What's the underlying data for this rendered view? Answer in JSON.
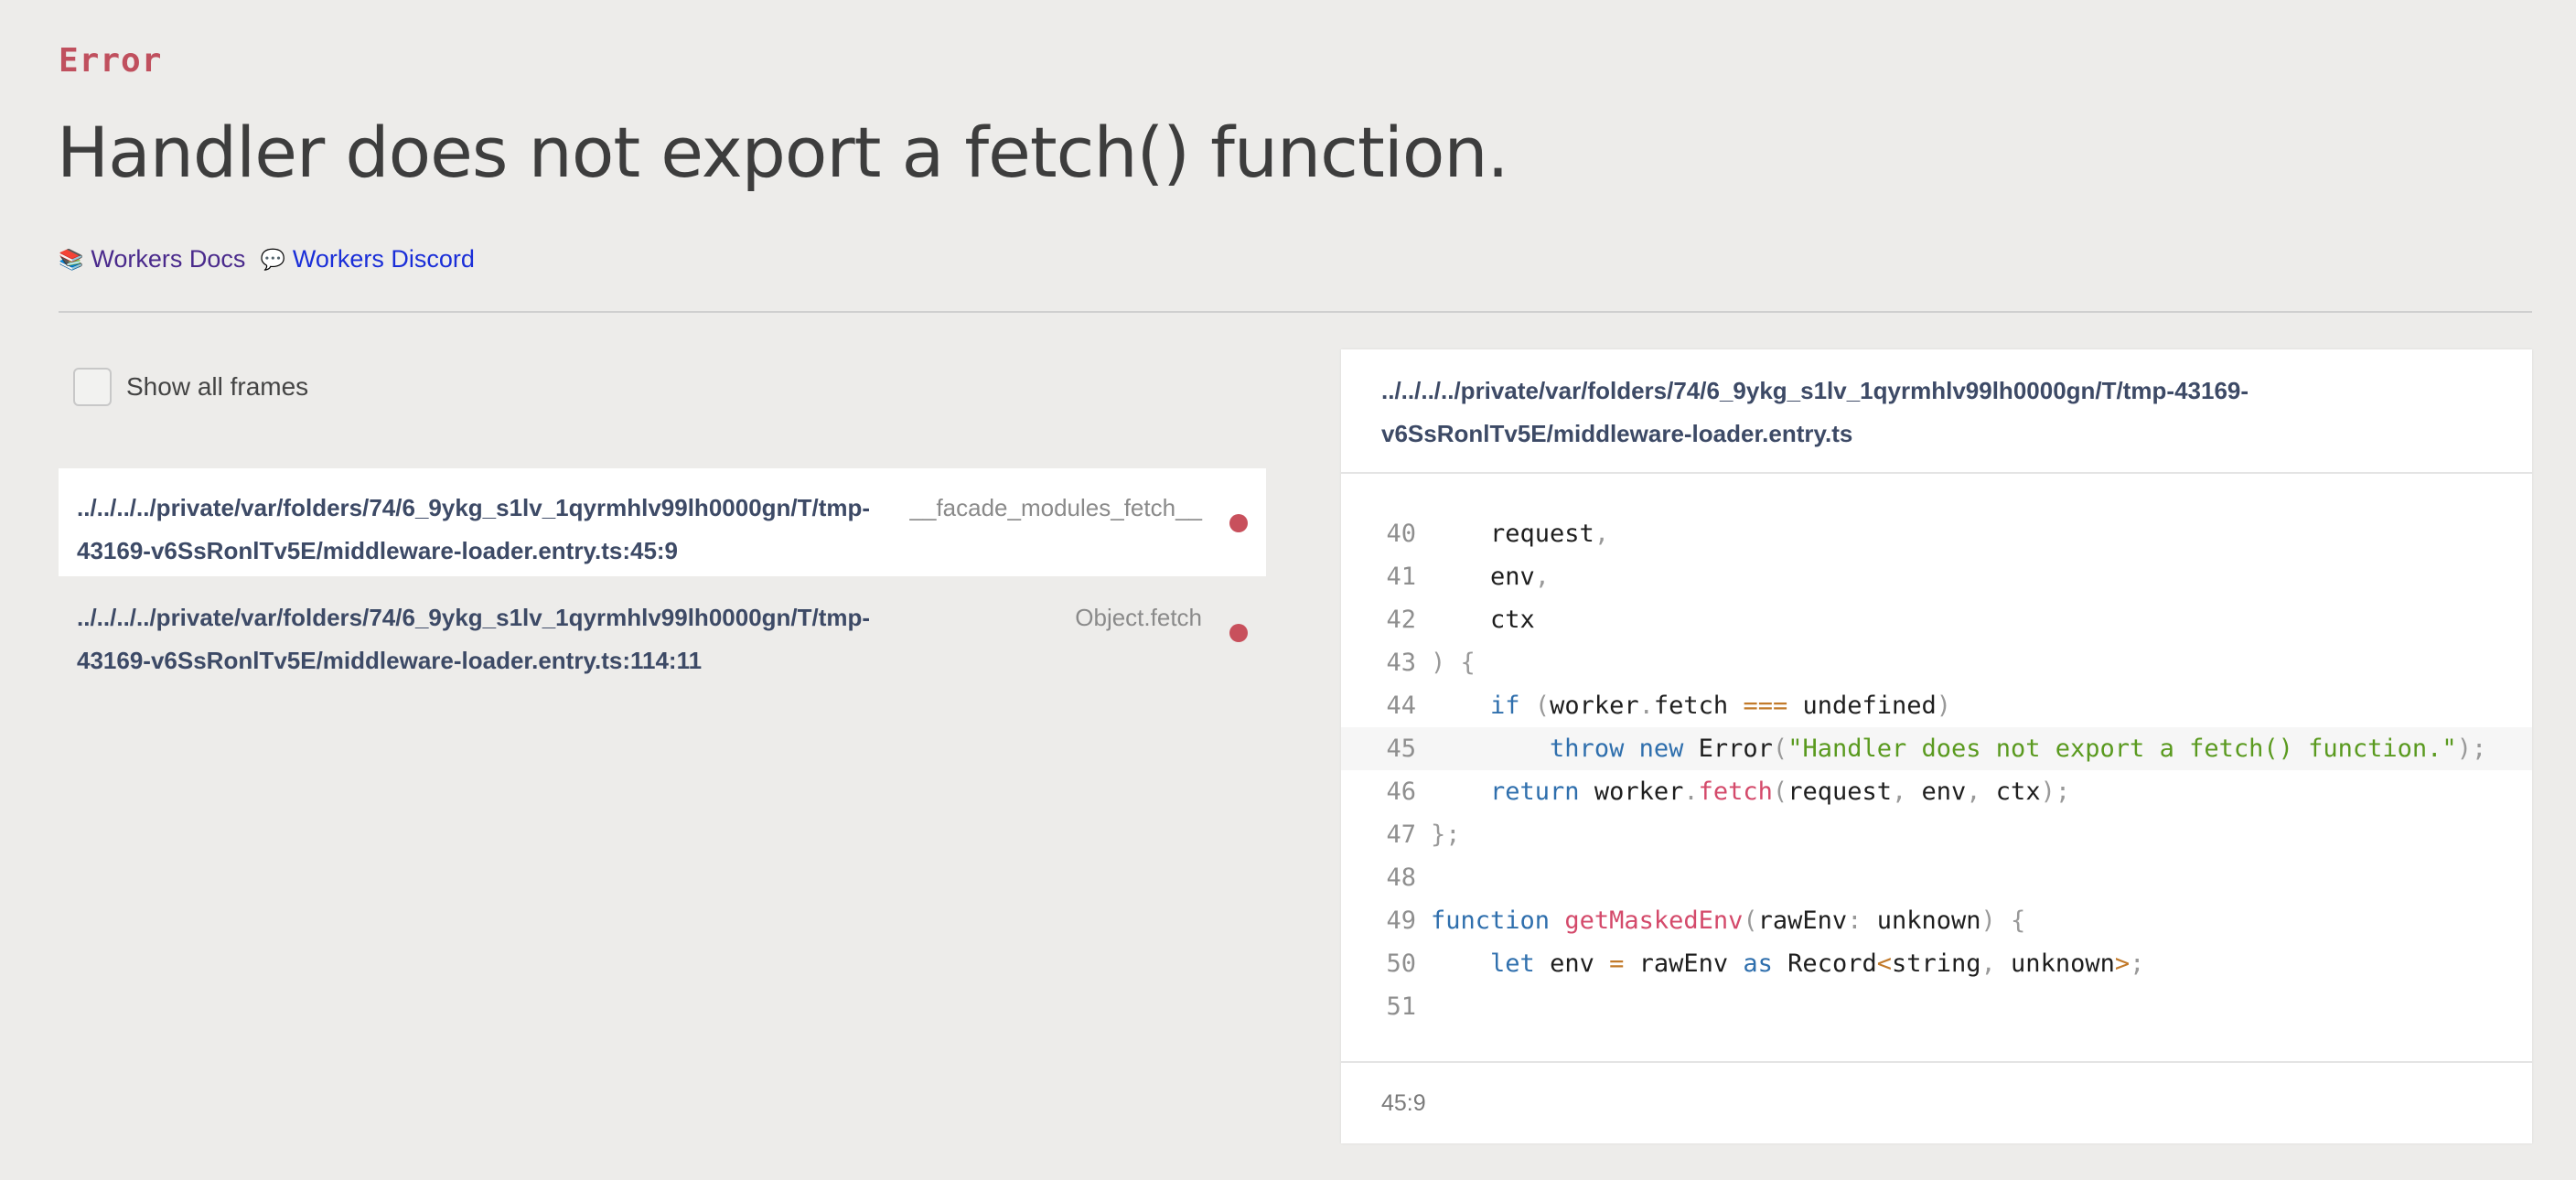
{
  "header": {
    "tag": "Error",
    "title": "Handler does not export a fetch() function."
  },
  "links": [
    {
      "icon": "books-emoji-icon",
      "glyph": "📚",
      "label": "Workers Docs",
      "color": "#4a2a8c"
    },
    {
      "icon": "speech-bubble-emoji-icon",
      "glyph": "💬",
      "label": "Workers Discord",
      "color": "#1a2ed8"
    }
  ],
  "frames_toggle": {
    "label": "Show all frames",
    "checked": false
  },
  "frames": [
    {
      "location": "../../../../private/var/folders/74/6_9ykg_s1lv_1qyrmhlv99lh0000gn/T/tmp-43169-v6SsRonlTv5E/middleware-loader.entry.ts:45:9",
      "function": "__facade_modules_fetch__",
      "active": true
    },
    {
      "location": "../../../../private/var/folders/74/6_9ykg_s1lv_1qyrmhlv99lh0000gn/T/tmp-43169-v6SsRonlTv5E/middleware-loader.entry.ts:114:11",
      "function": "Object.fetch",
      "active": false
    }
  ],
  "code_panel": {
    "file_path": "../../../../private/var/folders/74/6_9ykg_s1lv_1qyrmhlv99lh0000gn/T/tmp-43169-v6SsRonlTv5E/middleware-loader.entry.ts",
    "highlight_line": 45,
    "lines": [
      {
        "n": "40",
        "tokens": [
          [
            "pl",
            "    request"
          ],
          [
            "pn",
            ","
          ]
        ]
      },
      {
        "n": "41",
        "tokens": [
          [
            "pl",
            "    env"
          ],
          [
            "pn",
            ","
          ]
        ]
      },
      {
        "n": "42",
        "tokens": [
          [
            "pl",
            "    ctx"
          ]
        ]
      },
      {
        "n": "43",
        "tokens": [
          [
            "pn",
            ") {"
          ]
        ]
      },
      {
        "n": "44",
        "tokens": [
          [
            "pl",
            "    "
          ],
          [
            "kw",
            "if"
          ],
          [
            "pl",
            " "
          ],
          [
            "pn",
            "("
          ],
          [
            "pl",
            "worker"
          ],
          [
            "pn",
            "."
          ],
          [
            "pl",
            "fetch "
          ],
          [
            "op",
            "==="
          ],
          [
            "pl",
            " undefined"
          ],
          [
            "pn",
            ")"
          ]
        ]
      },
      {
        "n": "45",
        "tokens": [
          [
            "pl",
            "        "
          ],
          [
            "kw",
            "throw"
          ],
          [
            "pl",
            " "
          ],
          [
            "kw",
            "new"
          ],
          [
            "pl",
            " Error"
          ],
          [
            "pn",
            "("
          ],
          [
            "str",
            "\"Handler does not export a fetch() function.\""
          ],
          [
            "pn",
            ");"
          ]
        ]
      },
      {
        "n": "46",
        "tokens": [
          [
            "pl",
            "    "
          ],
          [
            "kw",
            "return"
          ],
          [
            "pl",
            " worker"
          ],
          [
            "pn",
            "."
          ],
          [
            "fn",
            "fetch"
          ],
          [
            "pn",
            "("
          ],
          [
            "pl",
            "request"
          ],
          [
            "pn",
            ","
          ],
          [
            "pl",
            " env"
          ],
          [
            "pn",
            ","
          ],
          [
            "pl",
            " ctx"
          ],
          [
            "pn",
            ");"
          ]
        ]
      },
      {
        "n": "47",
        "tokens": [
          [
            "pn",
            "};"
          ]
        ]
      },
      {
        "n": "48",
        "tokens": []
      },
      {
        "n": "49",
        "tokens": [
          [
            "kw",
            "function"
          ],
          [
            "pl",
            " "
          ],
          [
            "fn",
            "getMaskedEnv"
          ],
          [
            "pn",
            "("
          ],
          [
            "pl",
            "rawEnv"
          ],
          [
            "pn",
            ":"
          ],
          [
            "pl",
            " unknown"
          ],
          [
            "pn",
            ") {"
          ]
        ]
      },
      {
        "n": "50",
        "tokens": [
          [
            "pl",
            "    "
          ],
          [
            "kw",
            "let"
          ],
          [
            "pl",
            " env "
          ],
          [
            "op",
            "="
          ],
          [
            "pl",
            " rawEnv "
          ],
          [
            "kw",
            "as"
          ],
          [
            "pl",
            " Record"
          ],
          [
            "op",
            "<"
          ],
          [
            "pl",
            "string"
          ],
          [
            "pn",
            ","
          ],
          [
            "pl",
            " unknown"
          ],
          [
            "op",
            ">"
          ],
          [
            "pn",
            ";"
          ]
        ]
      },
      {
        "n": "51",
        "tokens": []
      }
    ],
    "position": "45:9"
  }
}
